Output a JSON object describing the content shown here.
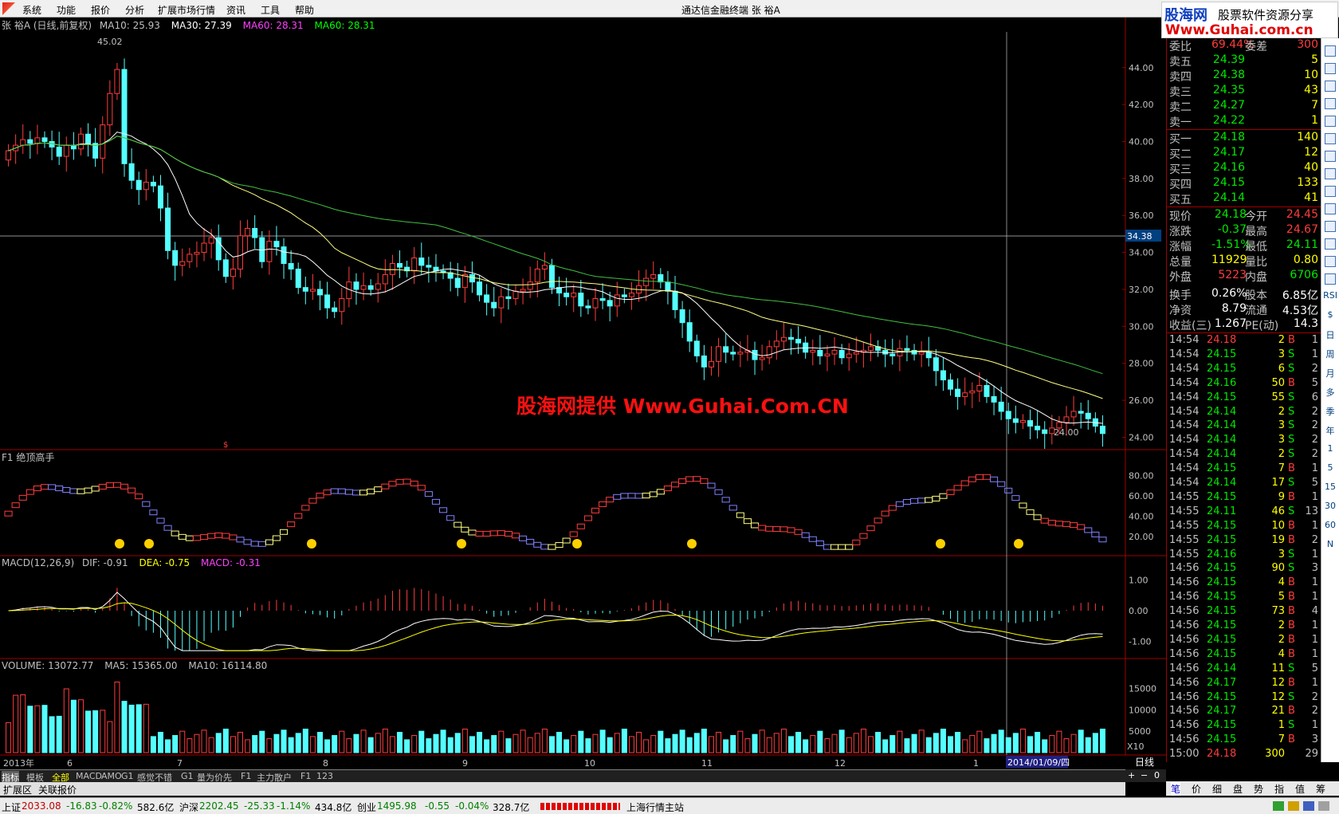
{
  "menu": {
    "items": [
      "系统",
      "功能",
      "报价",
      "分析",
      "扩展市场行情",
      "资讯",
      "工具",
      "帮助"
    ],
    "window_title": "通达信金融终端",
    "stock_title": "张   裕A"
  },
  "brand": {
    "name": "股海网",
    "slogan": "股票软件资源分享",
    "url": "Www.Guhai.com.cn"
  },
  "watermark": "股海网提供 Www.Guhai.Com.CN",
  "main_chart": {
    "header_name": "张  裕A",
    "header_period": "(日线,前复权)",
    "ma10": "MA10: 25.93",
    "ma30": "MA30: 27.39",
    "ma60a": "MA60: 28.31",
    "ma60b": "MA60: 28.31",
    "high_label": "45.02",
    "low_label": "24.00",
    "cursor_price": "34.38",
    "y_ticks": [
      "44.00",
      "42.00",
      "40.00",
      "38.00",
      "36.00",
      "34.00",
      "32.00",
      "30.00",
      "28.00",
      "26.00",
      "24.00"
    ]
  },
  "f1_panel": {
    "title": "F1 绝顶高手",
    "y_ticks": [
      "80.00",
      "60.00",
      "40.00",
      "20.00"
    ]
  },
  "macd_panel": {
    "title": "MACD(12,26,9)",
    "dif": "DIF: -0.91",
    "dea": "DEA: -0.75",
    "macd": "MACD: -0.31",
    "y_ticks": [
      "1.00",
      "0.00",
      "-1.00"
    ]
  },
  "volume_panel": {
    "title": "VOLUME: 13072.77",
    "ma5": "MA5: 15365.00",
    "ma10": "MA10: 16114.80",
    "y_ticks": [
      "15000",
      "10000",
      "5000"
    ],
    "unit": "X10"
  },
  "date_axis": {
    "labels": [
      "2013年",
      "6",
      "7",
      "8",
      "9",
      "10",
      "11",
      "12",
      "1"
    ],
    "cursor_date": "2014/01/09/四",
    "period": "日线"
  },
  "order_book": {
    "header": {
      "label1": "委比",
      "value1": "69.44%",
      "label2": "委差",
      "value2": "300"
    },
    "sells": [
      {
        "label": "卖五",
        "price": "24.39",
        "qty": "5"
      },
      {
        "label": "卖四",
        "price": "24.38",
        "qty": "10"
      },
      {
        "label": "卖三",
        "price": "24.35",
        "qty": "43"
      },
      {
        "label": "卖二",
        "price": "24.27",
        "qty": "7"
      },
      {
        "label": "卖一",
        "price": "24.22",
        "qty": "1"
      }
    ],
    "buys": [
      {
        "label": "买一",
        "price": "24.18",
        "qty": "140"
      },
      {
        "label": "买二",
        "price": "24.17",
        "qty": "12"
      },
      {
        "label": "买三",
        "price": "24.16",
        "qty": "40"
      },
      {
        "label": "买四",
        "price": "24.15",
        "qty": "133"
      },
      {
        "label": "买五",
        "price": "24.14",
        "qty": "41"
      }
    ]
  },
  "quote": [
    {
      "l1": "现价",
      "v1": "24.18",
      "l2": "今开",
      "v2": "24.45"
    },
    {
      "l1": "涨跌",
      "v1": "-0.37",
      "l2": "最高",
      "v2": "24.67"
    },
    {
      "l1": "涨幅",
      "v1": "-1.51%",
      "l2": "最低",
      "v2": "24.11"
    },
    {
      "l1": "总量",
      "v1": "11929",
      "l2": "量比",
      "v2": "0.80"
    },
    {
      "l1": "外盘",
      "v1": "5223",
      "l2": "内盘",
      "v2": "6706"
    },
    {
      "l1": "换手",
      "v1": "0.26%",
      "l2": "股本",
      "v2": "6.85亿"
    },
    {
      "l1": "净资",
      "v1": "8.79",
      "l2": "流通",
      "v2": "4.53亿"
    },
    {
      "l1": "收益(三)",
      "v1": "1.267",
      "l2": "PE(动)",
      "v2": "14.3"
    }
  ],
  "ticks": [
    [
      "14:54",
      "24.18",
      "2",
      "B",
      "1"
    ],
    [
      "14:54",
      "24.15",
      "3",
      "S",
      "1"
    ],
    [
      "14:54",
      "24.15",
      "6",
      "S",
      "2"
    ],
    [
      "14:54",
      "24.16",
      "50",
      "B",
      "5"
    ],
    [
      "14:54",
      "24.15",
      "55",
      "S",
      "6"
    ],
    [
      "14:54",
      "24.14",
      "2",
      "S",
      "2"
    ],
    [
      "14:54",
      "24.14",
      "3",
      "S",
      "2"
    ],
    [
      "14:54",
      "24.14",
      "3",
      "S",
      "2"
    ],
    [
      "14:54",
      "24.14",
      "2",
      "S",
      "2"
    ],
    [
      "14:54",
      "24.15",
      "7",
      "B",
      "1"
    ],
    [
      "14:54",
      "24.14",
      "17",
      "S",
      "5"
    ],
    [
      "14:55",
      "24.15",
      "9",
      "B",
      "1"
    ],
    [
      "14:55",
      "24.11",
      "46",
      "S",
      "13"
    ],
    [
      "14:55",
      "24.15",
      "10",
      "B",
      "1"
    ],
    [
      "14:55",
      "24.15",
      "19",
      "B",
      "2"
    ],
    [
      "14:55",
      "24.16",
      "3",
      "S",
      "1"
    ],
    [
      "14:56",
      "24.15",
      "90",
      "S",
      "3"
    ],
    [
      "14:56",
      "24.15",
      "4",
      "B",
      "1"
    ],
    [
      "14:56",
      "24.15",
      "5",
      "B",
      "1"
    ],
    [
      "14:56",
      "24.15",
      "73",
      "B",
      "4"
    ],
    [
      "14:56",
      "24.15",
      "2",
      "B",
      "1"
    ],
    [
      "14:56",
      "24.15",
      "2",
      "B",
      "1"
    ],
    [
      "14:56",
      "24.15",
      "4",
      "B",
      "1"
    ],
    [
      "14:56",
      "24.14",
      "11",
      "S",
      "5"
    ],
    [
      "14:56",
      "24.17",
      "12",
      "B",
      "1"
    ],
    [
      "14:56",
      "24.15",
      "12",
      "S",
      "2"
    ],
    [
      "14:56",
      "24.17",
      "21",
      "B",
      "2"
    ],
    [
      "14:56",
      "24.15",
      "1",
      "S",
      "1"
    ],
    [
      "14:56",
      "24.15",
      "7",
      "B",
      "3"
    ],
    [
      "15:00",
      "24.18",
      "300",
      "",
      "29"
    ]
  ],
  "bottom_tabs": [
    "指标",
    "模板",
    "全部",
    "MACD",
    "AMO",
    "G1",
    "感觉不错",
    "G1",
    "量为价先",
    "F1",
    "主力散户",
    "F1",
    "123"
  ],
  "ext_tabs": [
    "扩展区",
    "关联报价"
  ],
  "right_tabs": [
    "笔",
    "价",
    "细",
    "盘",
    "势",
    "指",
    "值",
    "筹"
  ],
  "nav_buttons": [
    "+",
    "−",
    "0"
  ],
  "sidebar_labels": [
    "RSI",
    "$",
    "日",
    "周",
    "月",
    "多",
    "季",
    "年",
    "1",
    "5",
    "15",
    "30",
    "60",
    "N"
  ],
  "status": {
    "sh_name": "上证",
    "sh_val": "2033.08",
    "sh_chg": "-16.83",
    "sh_pct": "-0.82%",
    "sh_amt": "582.6亿",
    "sz_name": "沪深",
    "sz_val": "2202.45",
    "sz_chg": "-25.33",
    "sz_pct": "-1.14%",
    "sz_amt": "434.8亿",
    "cy_name": "创业",
    "cy_val": "1495.98",
    "cy_chg": "-0.55",
    "cy_pct": "-0.04%",
    "cy_amt": "328.7亿",
    "server": "上海行情主站"
  },
  "chart_data": {
    "type": "candlestick",
    "closes": [
      39.5,
      39.8,
      40.1,
      39.9,
      40.2,
      40.0,
      39.7,
      39.2,
      39.8,
      39.6,
      40.4,
      39.9,
      39.1,
      40.9,
      42.6,
      43.9,
      38.8,
      37.9,
      37.4,
      37.8,
      37.6,
      36.4,
      34.1,
      33.3,
      33.5,
      33.9,
      34.0,
      34.5,
      34.8,
      33.6,
      32.7,
      33.1,
      34.9,
      35.3,
      34.8,
      33.5,
      34.6,
      34.3,
      33.4,
      33.1,
      32.1,
      31.9,
      32.0,
      31.7,
      31.0,
      30.8,
      31.5,
      32.4,
      32.0,
      32.2,
      32.0,
      32.3,
      32.8,
      33.4,
      33.2,
      33.0,
      33.7,
      33.3,
      33.2,
      33.0,
      32.9,
      32.6,
      32.1,
      32.8,
      32.4,
      31.7,
      31.3,
      31.0,
      31.6,
      31.5,
      31.9,
      32.0,
      32.4,
      33.1,
      33.3,
      32.1,
      31.8,
      31.6,
      31.8,
      31.1,
      31.0,
      31.5,
      31.4,
      31.1,
      31.7,
      31.6,
      31.8,
      32.2,
      32.6,
      32.8,
      32.4,
      31.9,
      30.9,
      30.2,
      29.2,
      28.4,
      27.8,
      28.1,
      28.9,
      28.6,
      28.5,
      28.6,
      28.7,
      28.2,
      28.3,
      28.9,
      29.2,
      29.4,
      29.3,
      29.1,
      28.6,
      28.7,
      28.4,
      28.5,
      28.7,
      28.3,
      28.5,
      28.6,
      28.7,
      28.9,
      28.7,
      28.5,
      28.4,
      28.8,
      28.7,
      28.5,
      28.6,
      28.3,
      27.6,
      27.1,
      26.6,
      26.2,
      26.4,
      26.5,
      26.8,
      26.2,
      25.9,
      25.4,
      25.0,
      24.8,
      24.9,
      24.6,
      24.4,
      24.2,
      24.5,
      24.8,
      25.1,
      25.4,
      25.3,
      25.0,
      24.6,
      24.2
    ],
    "ylim": [
      23.5,
      45.5
    ]
  }
}
